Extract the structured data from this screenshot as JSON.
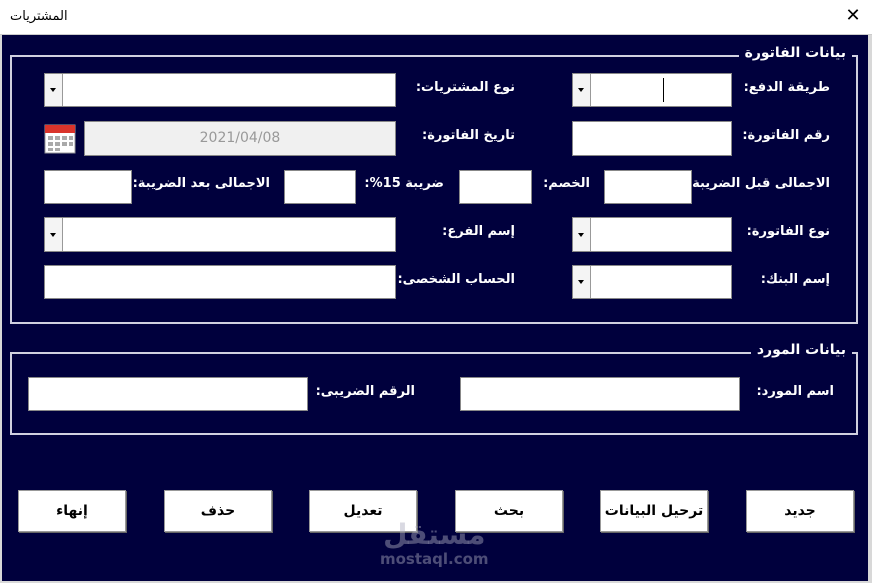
{
  "window": {
    "title": "المشتريات",
    "close_icon": "close-icon"
  },
  "invoice_group": {
    "legend": "بيانات الفاتورة",
    "payment_method": {
      "label": "طريقة الدفع:",
      "value": ""
    },
    "purchase_type": {
      "label": "نوع المشتريات:",
      "value": ""
    },
    "invoice_number": {
      "label": "رقم الفاتورة:",
      "value": ""
    },
    "invoice_date": {
      "label": "تاريخ الفاتورة:",
      "value": "2021/04/08",
      "icon": "calendar-icon"
    },
    "total_before_tax": {
      "label": "الاجمالى قبل الضريبة:",
      "value": ""
    },
    "discount": {
      "label": "الخصم:",
      "value": ""
    },
    "tax": {
      "label": "ضريبة 15%:",
      "value": ""
    },
    "total_after_tax": {
      "label": "الاجمالى بعد الضريبة:",
      "value": ""
    },
    "invoice_type": {
      "label": "نوع الفاتورة:",
      "value": ""
    },
    "branch_name": {
      "label": "إسم الفرع:",
      "value": ""
    },
    "bank_name": {
      "label": "إسم البنك:",
      "value": ""
    },
    "personal_account": {
      "label": "الحساب الشخصى:",
      "value": ""
    }
  },
  "supplier_group": {
    "legend": "بيانات المورد",
    "supplier_name": {
      "label": "اسم المورد:",
      "value": ""
    },
    "tax_number": {
      "label": "الرقم الضريبى:",
      "value": ""
    }
  },
  "buttons": {
    "new": "جديد",
    "post": "ترحيل البيانات",
    "search": "بحث",
    "edit": "تعديل",
    "delete": "حذف",
    "exit": "إنهاء"
  },
  "watermark": {
    "arabic": "مستقل",
    "latin": "mostaql.com"
  },
  "colors": {
    "form_bg": "#00003d"
  }
}
